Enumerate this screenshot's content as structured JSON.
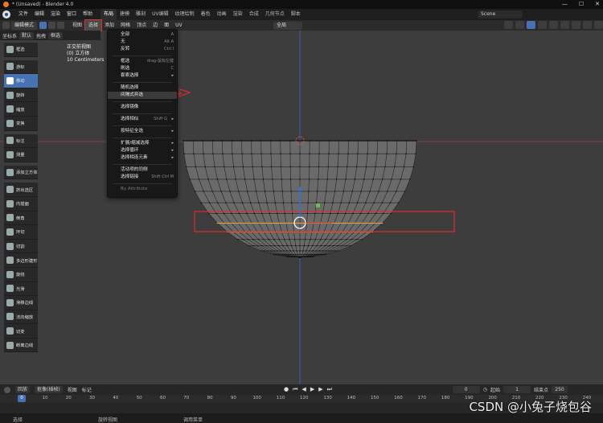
{
  "window": {
    "title": "* (Unsaved) - Blender 4.0"
  },
  "menubar": {
    "items": [
      "文件",
      "编辑",
      "渲染",
      "窗口",
      "帮助"
    ],
    "workspaces": [
      "布局",
      "建模",
      "雕刻",
      "UV编辑",
      "纹理绘制",
      "着色",
      "动画",
      "渲染",
      "合成",
      "几何节点",
      "脚本"
    ],
    "active_workspace": "布局",
    "scene": "Scene"
  },
  "header": {
    "mode": "编辑模式",
    "menus": [
      "视图",
      "选择",
      "添加",
      "网格",
      "顶点",
      "边",
      "面",
      "UV"
    ],
    "active_menu": "选择",
    "transform_orientation": "全局"
  },
  "tool_header": {
    "coord_label": "坐标系",
    "coord_value": "默认",
    "drag_label": "拖拽",
    "drag_value": "框选"
  },
  "viewport_overlay": {
    "view_name": "正交前视图",
    "object": "(0) 立方体",
    "scale": "10 Centimeters"
  },
  "toolbar": [
    {
      "label": "框选",
      "icon": "select-box-icon"
    },
    {
      "label": "游标",
      "icon": "cursor-icon"
    },
    {
      "label": "移动",
      "icon": "move-icon",
      "active": true
    },
    {
      "label": "旋转",
      "icon": "rotate-icon"
    },
    {
      "label": "缩放",
      "icon": "scale-icon"
    },
    {
      "label": "变换",
      "icon": "transform-icon"
    },
    {
      "label": "标注",
      "icon": "annotate-icon"
    },
    {
      "label": "测量",
      "icon": "measure-icon"
    },
    {
      "label": "添加立方体",
      "icon": "add-cube-icon"
    },
    {
      "label": "挤出选区",
      "icon": "extrude-icon"
    },
    {
      "label": "内插面",
      "icon": "inset-icon"
    },
    {
      "label": "倒角",
      "icon": "bevel-icon"
    },
    {
      "label": "环切",
      "icon": "loop-cut-icon"
    },
    {
      "label": "切割",
      "icon": "knife-icon"
    },
    {
      "label": "多边形建形",
      "icon": "poly-build-icon"
    },
    {
      "label": "旋绕",
      "icon": "spin-icon"
    },
    {
      "label": "光滑",
      "icon": "smooth-icon"
    },
    {
      "label": "滑移边线",
      "icon": "edge-slide-icon"
    },
    {
      "label": "法向缩放",
      "icon": "shrink-fatten-icon"
    },
    {
      "label": "切变",
      "icon": "shear-icon"
    },
    {
      "label": "断离边线",
      "icon": "rip-edge-icon"
    }
  ],
  "select_menu": [
    {
      "label": "全部",
      "shortcut": "A"
    },
    {
      "label": "无",
      "shortcut": "Alt A"
    },
    {
      "label": "反转",
      "shortcut": "Ctrl I"
    },
    {
      "sep": true
    },
    {
      "label": "框选",
      "shortcut": "drag-鼠标左键"
    },
    {
      "label": "刷选",
      "shortcut": "C"
    },
    {
      "label": "套索选择",
      "arrow": true
    },
    {
      "sep": true
    },
    {
      "label": "随机选择"
    },
    {
      "label": "间隔式弃选",
      "highlighted": true
    },
    {
      "sep": true
    },
    {
      "label": "选择镜像"
    },
    {
      "sep": true
    },
    {
      "label": "选择相似",
      "shortcut": "Shift G",
      "arrow": true
    },
    {
      "sep": true
    },
    {
      "label": "按特征全选",
      "arrow": true
    },
    {
      "sep": true
    },
    {
      "label": "扩展/缩减选择",
      "arrow": true
    },
    {
      "label": "选择循环",
      "arrow": true
    },
    {
      "label": "选择相连元素",
      "arrow": true
    },
    {
      "sep": true
    },
    {
      "label": "活动项的同侧"
    },
    {
      "label": "选择链接",
      "shortcut": "Shift Ctrl M"
    },
    {
      "sep": true
    },
    {
      "label": "By Attribute",
      "dim": true
    }
  ],
  "timeline": {
    "menus": [
      "回放",
      "抠像(插帧)",
      "视图",
      "标记"
    ],
    "current_frame": "0",
    "start_label": "起始",
    "start": "1",
    "end_label": "结束点",
    "end": "250",
    "ruler": [
      "10",
      "20",
      "30",
      "40",
      "50",
      "60",
      "70",
      "80",
      "90",
      "100",
      "110",
      "120",
      "130",
      "140",
      "150",
      "160",
      "170",
      "180",
      "190",
      "200",
      "210",
      "220",
      "230",
      "240"
    ]
  },
  "statusbar": {
    "left": "选择",
    "middle": "旋转视图",
    "right": "调用菜单"
  },
  "watermark": "CSDN @小兔子烧包谷",
  "colors": {
    "accent": "#4772b3",
    "highlight_red": "#e02a2a",
    "selected_edges": "#f0a030"
  }
}
